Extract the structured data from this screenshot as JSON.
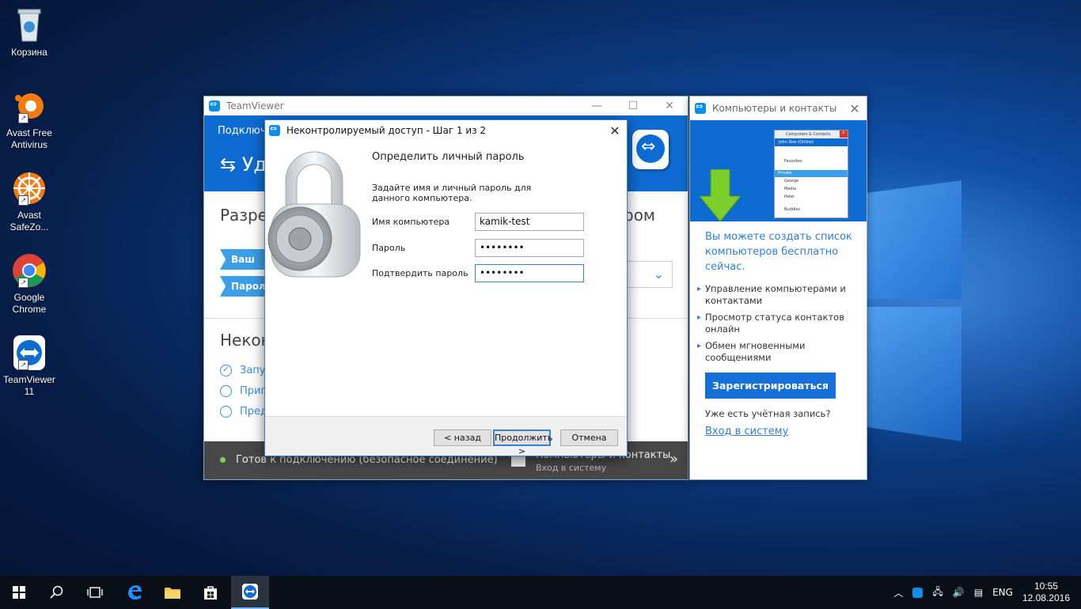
{
  "desktop": {
    "icons": [
      {
        "label": "Корзина",
        "icon": "recycle-bin-icon"
      },
      {
        "label": "Avast Free Antivirus",
        "icon": "avast-icon"
      },
      {
        "label": "Avast SafeZo...",
        "icon": "avast-safezone-icon"
      },
      {
        "label": "Google Chrome",
        "icon": "chrome-icon"
      },
      {
        "label": "TeamViewer 11",
        "icon": "teamviewer-icon"
      }
    ]
  },
  "tv_main": {
    "title": "TeamViewer",
    "header_frag": "Подключ",
    "header_big_frag": "Уд",
    "heading_frag": "Разре",
    "heading_right_frag": "ром",
    "tag_id": "Ваш ID",
    "tag_pass": "Пароль",
    "heading2_frag": "Некон",
    "links": [
      "Запу",
      "Приг",
      "Пред"
    ],
    "status": "Готов к подключению (безопасное соединение)",
    "contacts_label": "Компьютеры и контакты",
    "contacts_sub": "Вход в систему"
  },
  "cc_window": {
    "title": "Компьютеры и контакты",
    "mini": {
      "title": "Computers & Contacts",
      "user": "John Doe (Online)",
      "group_head": "Favorites",
      "group": "Private",
      "items": [
        "George",
        "Media",
        "Peter"
      ],
      "footer": "Buddies"
    },
    "promo": "Вы можете создать список компьютеров бесплатно сейчас.",
    "bullets": [
      "Управление компьютерами и контактами",
      "Просмотр статуса контактов онлайн",
      "Обмен мгновенными сообщениями"
    ],
    "register_btn": "Зарегистрироваться",
    "have_account": "Уже есть учётная запись?",
    "login_link": "Вход в систему"
  },
  "dialog": {
    "title": "Неконтролируемый доступ - Шаг 1 из 2",
    "heading": "Определить личный пароль",
    "description": "Задайте имя и личный пароль для данного компьютера.",
    "fields": [
      {
        "label": "Имя компьютера",
        "value": "kamik-test"
      },
      {
        "label": "Пароль",
        "value": "••••••••"
      },
      {
        "label": "Подтвердить пароль",
        "value": "••••••••"
      }
    ],
    "btn_back": "< назад",
    "btn_next": "Продолжить >",
    "btn_cancel": "Отмена"
  },
  "taskbar": {
    "lang": "ENG",
    "time": "10:55",
    "date": "12.08.2016"
  }
}
